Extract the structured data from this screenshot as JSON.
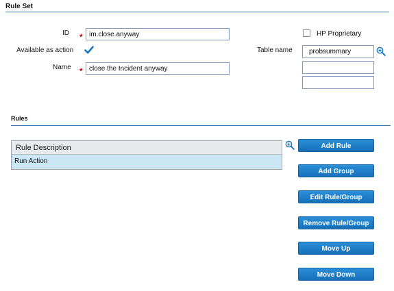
{
  "rule_set": {
    "title": "Rule Set",
    "id_label": "ID",
    "id_value": "im.close.anyway",
    "available_label": "Available as action",
    "available_checked": true,
    "name_label": "Name",
    "name_value": "close the Incident anyway",
    "hp_proprietary_label": "HP Proprietary",
    "hp_proprietary_checked": false,
    "table_name_label": "Table name",
    "table_names": [
      "probsummary",
      "",
      ""
    ],
    "required_marker": "*"
  },
  "rules": {
    "title": "Rules",
    "grid_header": "Rule Description",
    "rows": [
      "Run Action"
    ]
  },
  "buttons": {
    "add_rule": "Add Rule",
    "add_group": "Add Group",
    "edit": "Edit Rule/Group",
    "remove": "Remove Rule/Group",
    "move_up": "Move Up",
    "move_down": "Move Down"
  },
  "colors": {
    "accent": "#1a78c2",
    "required": "#d00000",
    "selected_row": "#cbe7f6"
  },
  "icons": {
    "zoom": "magnifier-plus-icon",
    "check": "checkmark-icon"
  }
}
